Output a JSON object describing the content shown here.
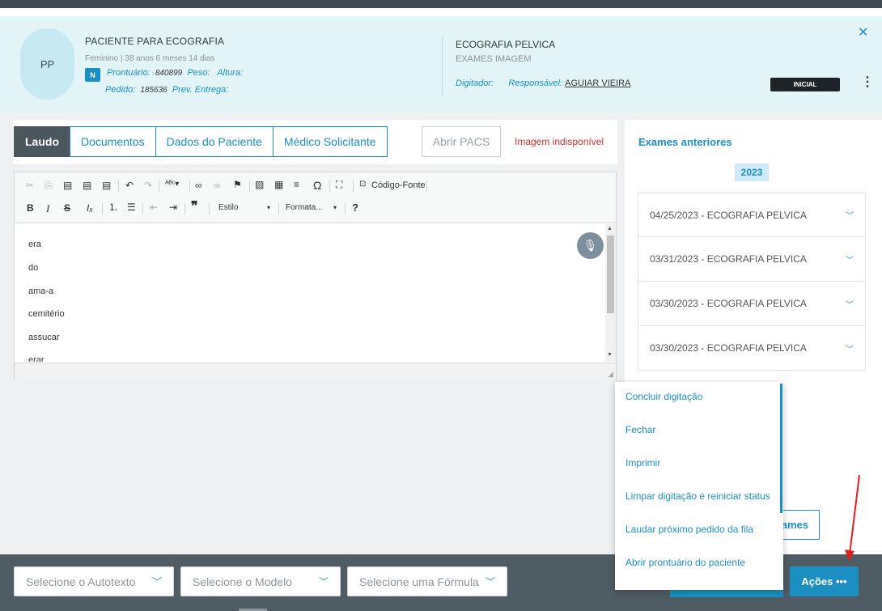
{
  "patient": {
    "initials": "PP",
    "name": "PACIENTE PARA ECOGRAFIA",
    "info": "Feminino | 38 anos 6 meses 14 dias",
    "badge": "N",
    "prontuario_label": "Prontuário:",
    "prontuario": "840899",
    "peso_label": "Peso:",
    "altura_label": "Altura:",
    "pedido_label": "Pedido:",
    "pedido": "185636",
    "prev_label": "Prev. Entrega:"
  },
  "exam": {
    "title": "ECOGRAFIA PELVICA",
    "subtitle": "EXAMES IMAGEM",
    "digitador_label": "Digitador:",
    "responsavel_label": "Responsável:",
    "responsavel": "AGUIAR VIEIRA",
    "status": "INICIAL"
  },
  "tabs": [
    "Laudo",
    "Documentos",
    "Dados do Paciente",
    "Médico Solicitante"
  ],
  "pacs_label": "Abrir PACS",
  "image_unavailable": "Imagem indisponível",
  "toolbar": {
    "source_label": "Código-Fonte",
    "style_label": "Estilo",
    "format_label": "Formata..."
  },
  "editor_lines": [
    "era",
    "do",
    "ama-a",
    "cemitério",
    "assucar",
    "erar"
  ],
  "previous_exams": {
    "title": "Exames anteriores",
    "year": "2023",
    "items": [
      "04/25/2023 - ECOGRAFIA PELVICA",
      "03/31/2023 - ECOGRAFIA PELVICA",
      "03/30/2023 - ECOGRAFIA PELVICA",
      "03/30/2023 - ECOGRAFIA PELVICA"
    ],
    "partial_button": "ames"
  },
  "actions_menu": [
    "Concluir digitação",
    "Fechar",
    "Imprimir",
    "Limpar digitação e reiniciar status",
    "Laudar próximo pedido da fila",
    "Abrir prontuário do paciente"
  ],
  "bottom": {
    "autotexto": "Selecione o Autotexto",
    "modelo": "Selecione o Modelo",
    "formula": "Selecione uma Fórmula",
    "acoes": "Ações"
  }
}
